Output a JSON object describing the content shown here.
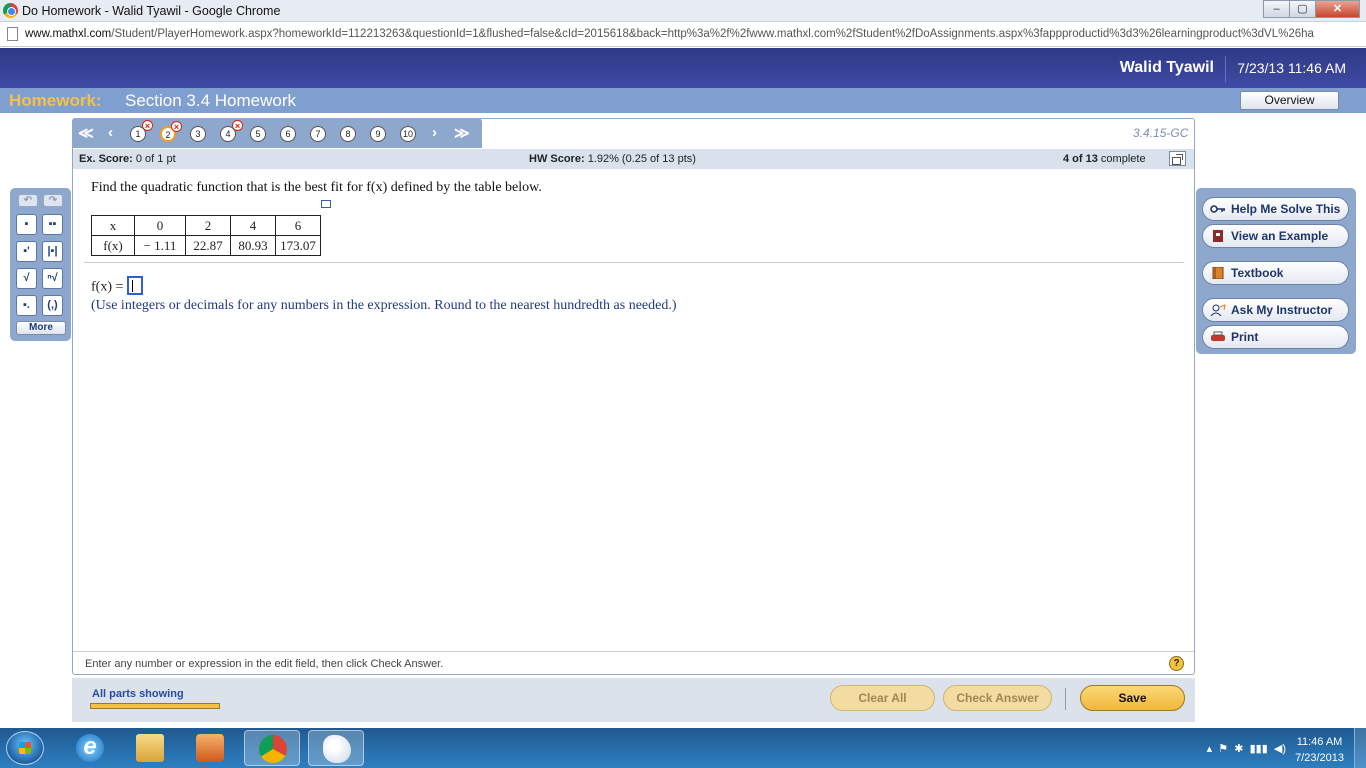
{
  "browser": {
    "window_title": "Do Homework - Walid Tyawil - Google Chrome",
    "url_host": "www.mathxl.com",
    "url_path": "/Student/PlayerHomework.aspx?homeworkId=112213263&questionId=1&flushed=false&cId=2015618&back=http%3a%2f%2fwww.mathxl.com%2fStudent%2fDoAssignments.aspx%3fappproductid%3d3%26learningproduct%3dVL%26ha",
    "minimize": "–",
    "maximize": "▢",
    "close": "✕"
  },
  "header": {
    "user_name": "Walid Tyawil",
    "datetime": "7/23/13 11:46 AM",
    "homework_label": "Homework:",
    "homework_title": "Section 3.4 Homework",
    "overview_button": "Overview"
  },
  "nav": {
    "questions": [
      {
        "num": "1",
        "incorrect": true,
        "current": false
      },
      {
        "num": "2",
        "incorrect": true,
        "current": true
      },
      {
        "num": "3",
        "incorrect": false,
        "current": false
      },
      {
        "num": "4",
        "incorrect": true,
        "current": false
      },
      {
        "num": "5",
        "incorrect": false,
        "current": false
      },
      {
        "num": "6",
        "incorrect": false,
        "current": false
      },
      {
        "num": "7",
        "incorrect": false,
        "current": false
      },
      {
        "num": "8",
        "incorrect": false,
        "current": false
      },
      {
        "num": "9",
        "incorrect": false,
        "current": false
      },
      {
        "num": "10",
        "incorrect": false,
        "current": false
      }
    ],
    "question_id": "3.4.15-GC"
  },
  "score": {
    "ex_label": "Ex. Score:",
    "ex_value": "0 of 1 pt",
    "hw_label": "HW Score:",
    "hw_value": "1.92% (0.25 of 13 pts)",
    "progress_bold": "4 of 13",
    "progress_rest": "complete"
  },
  "question": {
    "prompt": "Find the quadratic function that is the best fit for f(x) defined by the table below.",
    "table": {
      "x_label": "x",
      "fx_label": "f(x)",
      "x_values": [
        "0",
        "2",
        "4",
        "6"
      ],
      "fx_values": [
        "− 1.11",
        "22.87",
        "80.93",
        "173.07"
      ]
    },
    "answer_label": "f(x) =",
    "instructions": "(Use integers or decimals for any numbers in the expression. Round to the nearest hundredth as needed.)"
  },
  "footer": {
    "hint": "Enter any number or expression in the edit field, then click Check Answer.",
    "help": "?"
  },
  "tools": {
    "more": "More"
  },
  "help_panel": {
    "help_me_solve": "Help Me Solve This",
    "view_example": "View an Example",
    "textbook": "Textbook",
    "ask_instructor": "Ask My Instructor",
    "print": "Print"
  },
  "bottom": {
    "parts_showing": "All parts showing",
    "clear_all": "Clear All",
    "check_answer": "Check Answer",
    "save": "Save"
  },
  "taskbar": {
    "time": "11:46 AM",
    "date": "7/23/2013"
  }
}
